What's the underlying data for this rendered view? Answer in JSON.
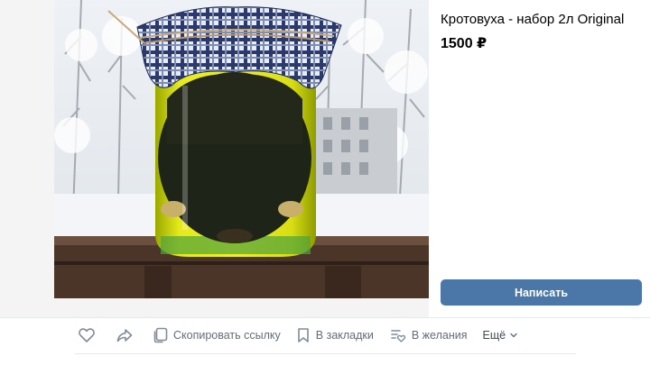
{
  "product": {
    "title": "Кротовуха - набор 2л Original",
    "price": "1500 ₽"
  },
  "buttons": {
    "write_label": "Написать"
  },
  "actions": {
    "copy_link_label": "Скопировать ссылку",
    "bookmarks_label": "В закладки",
    "wishlist_label": "В желания",
    "more_label": "Ещё"
  },
  "icons": {
    "like": "heart-icon",
    "share": "share-arrow-icon",
    "copy": "copy-icon",
    "bookmark": "bookmark-icon",
    "wishlist": "wishlist-icon",
    "more": "chevron-down-icon"
  },
  "colors": {
    "accent_button": "#4a76a8",
    "action_text": "#626d7a"
  }
}
